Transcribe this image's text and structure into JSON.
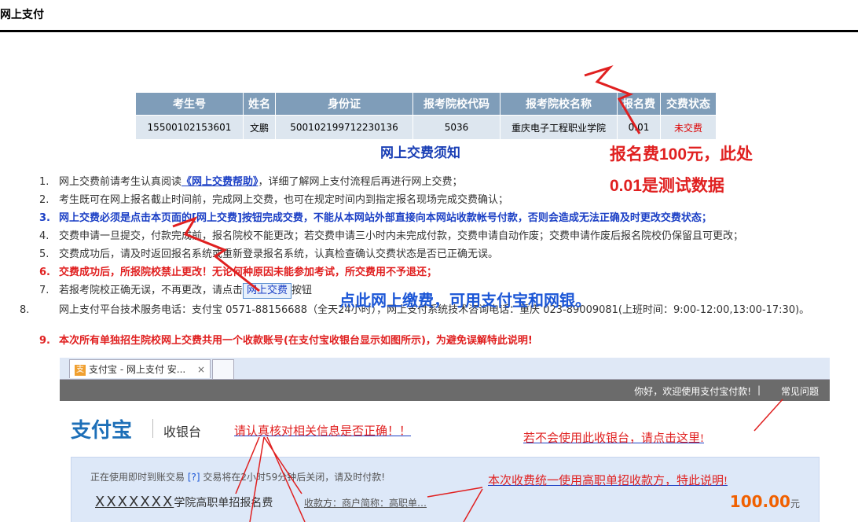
{
  "page": {
    "title": "网上支付"
  },
  "table": {
    "headers": [
      "考生号",
      "姓名",
      "身份证",
      "报考院校代码",
      "报考院校名称",
      "报名费",
      "交费状态"
    ],
    "row": [
      "15500102153601",
      "文鹏",
      "500102199712230136",
      "5036",
      "重庆电子工程职业学院",
      "0.01",
      "未交费"
    ]
  },
  "notice_title": "网上交费须知",
  "annotations": {
    "fee_line1": "报名费100元，此处",
    "fee_line2": "0.01是测试数据",
    "click_pay": "点此网上缴费，可用支付宝和网银。"
  },
  "steps": {
    "s1_pre": "网上交费前请考生认真阅读",
    "s1_link": "《网上交费帮助》",
    "s1_post": "，详细了解网上支付流程后再进行网上交费；",
    "s2": "考生既可在网上报名截止时间前，完成网上交费，也可在规定时间内到指定报名现场完成交费确认；",
    "s3": "网上交费必须是点击本页面的[网上交费]按钮完成交费，不能从本网站外部直接向本网站收款帐号付款，否则会造成无法正确及时更改交费状态；",
    "s4": "交费申请一旦提交，付款完成前，报名院校不能更改；若交费申请三小时内未完成付款，交费申请自动作废；交费申请作废后报名院校仍保留且可更改；",
    "s5": "交费成功后，请及时返回报名系统或重新登录报名系统，认真检查确认交费状态是否已正确无误。",
    "s6": "交费成功后，所报院校禁止更改！无论何种原因未能参加考试，所交费用不予退还；",
    "s7_pre": "若报考院校正确无误，不再更改，请点击",
    "s7_button": "网上交费",
    "s7_post": "按钮",
    "s8": "网上支付平台技术服务电话：支付宝  0571-88156688（全天24小时），网上支付系统技术咨询电话：重庆 023-89009081(上班时间：9:00-12:00,13:00-17:30)。",
    "s9": "本次所有单独招生院校网上交费共用一个收款账号(在支付宝收银台显示如图所示)，为避免误解特此说明!"
  },
  "embed": {
    "tab_title": "支付宝 - 网上支付 安...",
    "tab_close": "×",
    "welcome": "你好，欢迎使用支付宝付款!",
    "separator": "|",
    "faq": "常见问题",
    "logo": "支付宝",
    "cashier": "收银台",
    "warn_verify": "请认真核对相关信息是否正确！！",
    "warn_help": "若不会使用此收银台，请点击这里!",
    "trade_info": "正在使用即时到账交易",
    "trade_hint": "[?]",
    "trade_timer": "交易将在2小时59分钟后关闭，请及时付款!",
    "warn_payee": "本次收费统一使用高职单招收款方，特此说明!",
    "order_xx": "XXXXXXX",
    "order_rest": "学院高职单招报名费",
    "payee": "收款方：商户简称：高职单…",
    "amount": "100.00",
    "amount_unit": "元"
  },
  "colors": {
    "header_bg": "#7f9db9",
    "cell_bg": "#dde6ef",
    "accent_blue": "#1b3fc5",
    "accent_red": "#e02020",
    "amount": "#f06000"
  }
}
